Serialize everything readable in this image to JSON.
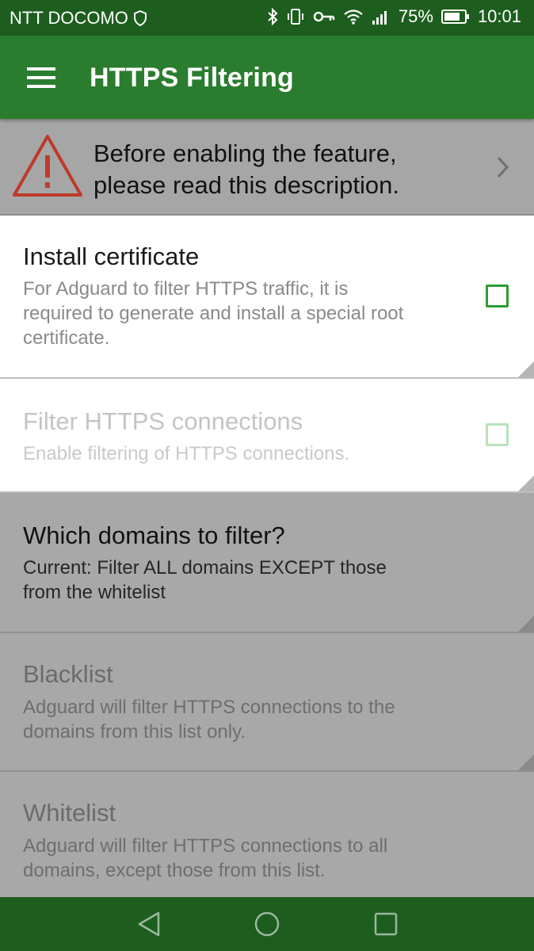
{
  "status_bar": {
    "carrier": "NTT DOCOMO",
    "battery_percent": "75%",
    "time": "10:01",
    "icons": [
      "shield-icon",
      "bluetooth-icon",
      "vibrate-icon",
      "vpn-key-icon",
      "wifi-icon",
      "signal-icon",
      "battery-icon"
    ]
  },
  "app_bar": {
    "menu_icon": "hamburger-menu-icon",
    "title": "HTTPS Filtering"
  },
  "banner": {
    "icon": "warning-icon",
    "line1": "Before enabling the feature,",
    "line2": "please read this description.",
    "chevron": "chevron-right-icon"
  },
  "settings": [
    {
      "title": "Install certificate",
      "desc_lines": [
        "For Adguard to filter HTTPS traffic, it is",
        "required to generate and install a special root",
        "certificate."
      ],
      "checked": false,
      "enabled": true
    },
    {
      "title": "Filter HTTPS connections",
      "desc_lines": [
        "Enable filtering of HTTPS connections."
      ],
      "checked": false,
      "enabled": false
    },
    {
      "title": "Which domains to filter?",
      "desc_lines": [
        "Current: Filter ALL domains EXCEPT those",
        "from the whitelist"
      ],
      "enabled": true
    },
    {
      "title": "Blacklist",
      "desc_lines": [
        "Adguard will filter HTTPS connections to the",
        "domains from this list only."
      ],
      "enabled": false
    },
    {
      "title": "Whitelist",
      "desc_lines": [
        "Adguard will filter HTTPS connections to all",
        "domains, except those from this list."
      ],
      "enabled": false
    }
  ],
  "nav_bar": {
    "buttons": [
      "back-icon",
      "home-icon",
      "recents-icon"
    ]
  },
  "colors": {
    "status_bar": "#1d5e1f",
    "app_bar": "#2a7d2e",
    "accent": "#2e9b35",
    "overlay_grey": "#a8a8a8"
  }
}
